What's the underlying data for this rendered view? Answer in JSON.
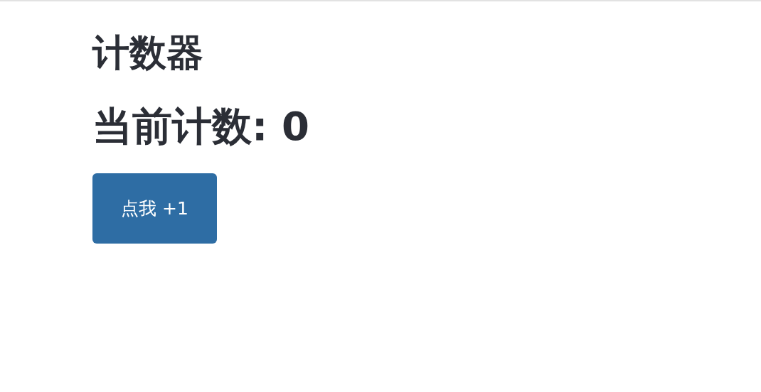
{
  "title": "计数器",
  "count_text": "当前计数: 0",
  "button": {
    "label": "点我 +1"
  }
}
